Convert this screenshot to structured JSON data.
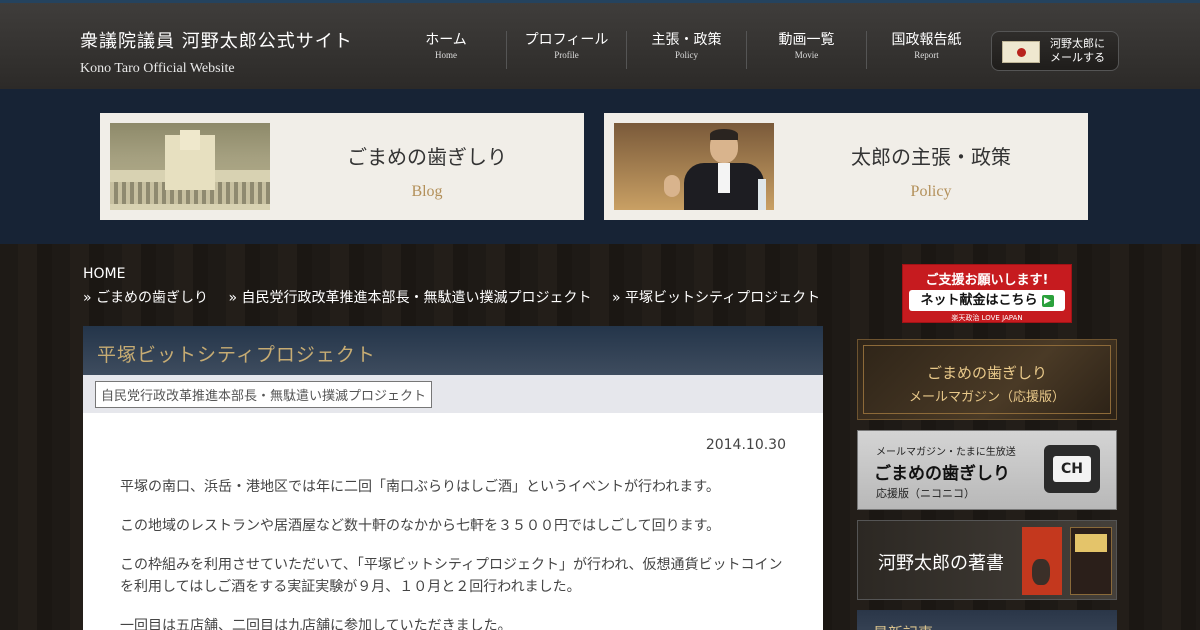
{
  "header": {
    "site_title": "衆議院議員 河野太郎公式サイト",
    "site_subtitle": "Kono Taro Official Website",
    "nav": [
      {
        "jp": "ホーム",
        "en": "Home"
      },
      {
        "jp": "プロフィール",
        "en": "Profile"
      },
      {
        "jp": "主張・政策",
        "en": "Policy"
      },
      {
        "jp": "動画一覧",
        "en": "Movie"
      },
      {
        "jp": "国政報告紙",
        "en": "Report"
      }
    ],
    "mail_button": {
      "line1": "河野太郎に",
      "line2": "メールする"
    }
  },
  "promos": [
    {
      "title": "ごまめの歯ぎしり",
      "subtitle": "Blog"
    },
    {
      "title": "太郎の主張・政策",
      "subtitle": "Policy"
    }
  ],
  "breadcrumb": {
    "home": "HOME",
    "items": [
      "» ごまめの歯ぎしり",
      "» 自民党行政改革推進本部長・無駄遣い撲滅プロジェクト",
      "» 平塚ビットシティプロジェクト"
    ]
  },
  "article": {
    "title": "平塚ビットシティプロジェクト",
    "category": "自民党行政改革推進本部長・無駄遣い撲滅プロジェクト",
    "date": "2014.10.30",
    "paragraphs": [
      "平塚の南口、浜岳・港地区では年に二回「南口ぶらりはしご酒」というイベントが行われます。",
      "この地域のレストランや居酒屋など数十軒のなかから七軒を３５００円ではしごして回ります。",
      "この枠組みを利用させていただいて、「平塚ビットシティプロジェクト」が行われ、仮想通貨ビットコインを利用してはしご酒をする実証実験が９月、１０月と２回行われました。",
      "一回目は五店舗、二回目は九店舗に参加していただきました。"
    ]
  },
  "sidebar": {
    "donate": {
      "line1": "ご支援お願いします!",
      "line2": "ネット献金はこちら",
      "line3": "楽天政治 LOVE JAPAN"
    },
    "mail_magazine": {
      "line1": "ごまめの歯ぎしり",
      "line2": "メールマガジン（応援版）"
    },
    "nico": {
      "line1": "メールマガジン・たまに生放送",
      "line2": "ごまめの歯ぎしり",
      "line3": "応援版（ニコニコ）"
    },
    "books": {
      "label": "河野太郎の著書"
    },
    "recent": {
      "label": "最新記事"
    }
  }
}
